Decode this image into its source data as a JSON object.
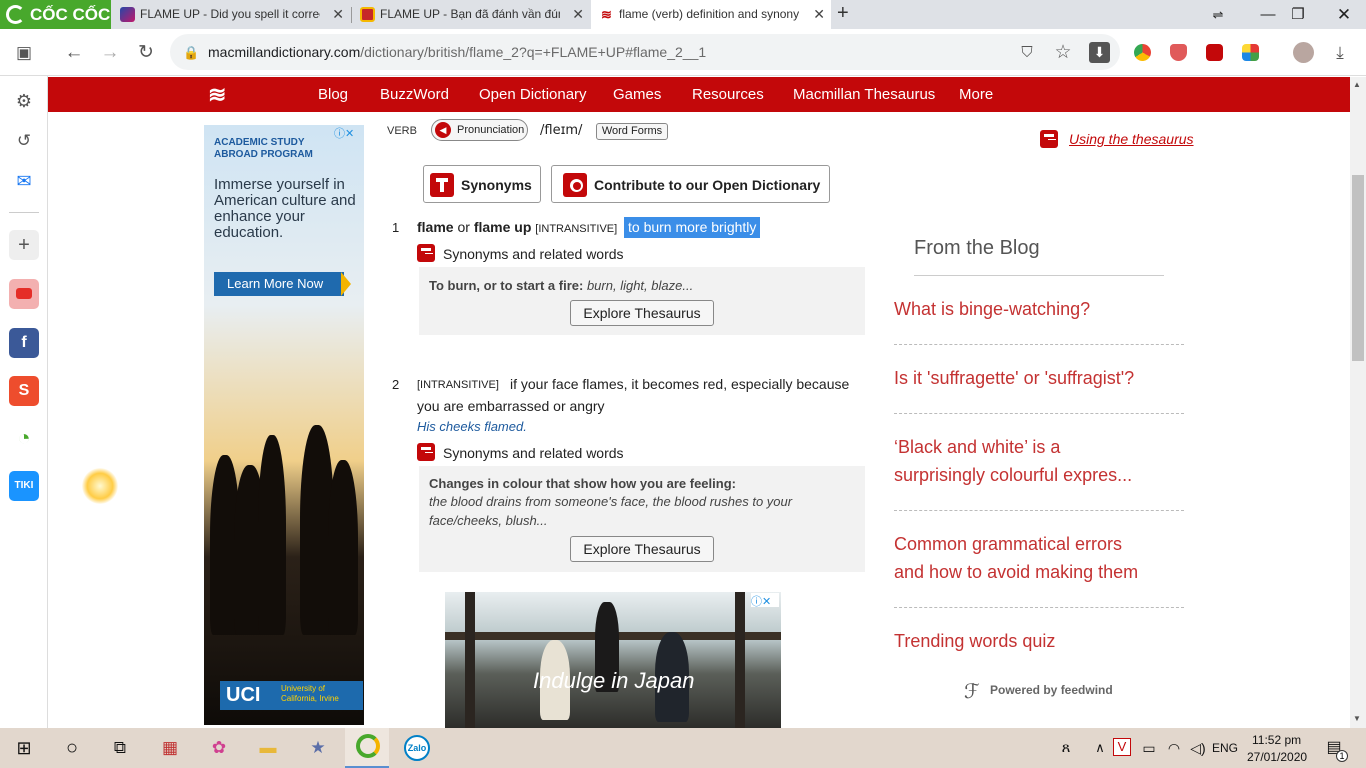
{
  "browser": {
    "brand": "CỐC CỐC",
    "tabs": [
      {
        "title": "FLAME UP - Did you spell it correctly",
        "active": false
      },
      {
        "title": "FLAME UP - Bạn đã đánh vần đúng",
        "active": false
      },
      {
        "title": "flame (verb) definition and synonyms",
        "active": true
      }
    ],
    "new_tab": "+",
    "url_host": "macmillandictionary.com",
    "url_path": "/dictionary/british/flame_2?q=+FLAME+UP#flame_2__1"
  },
  "site_nav": {
    "items": [
      "Blog",
      "BuzzWord",
      "Open Dictionary",
      "Games",
      "Resources",
      "Macmillan Thesaurus",
      "More"
    ]
  },
  "ad_left": {
    "kicker": "ACADEMIC STUDY ABROAD PROGRAM",
    "headline": "Immerse yourself in American culture and enhance your education.",
    "cta": "Learn More Now",
    "logo": "UCI",
    "logo_text": "University of California, Irvine"
  },
  "entry": {
    "pos": "VERB",
    "pronunciation_label": "Pronunciation",
    "ipa": "/fleɪm/",
    "word_forms": "Word Forms",
    "synonyms_btn": "Synonyms",
    "contribute_btn": "Contribute to our Open Dictionary",
    "thesaurus_link": "Using the thesaurus",
    "senses": [
      {
        "num": "1",
        "head1": "flame",
        "or": "or",
        "head2": "flame up",
        "label": "[INTRANSITIVE]",
        "definition": "to burn more brightly",
        "syn_label": "Synonyms and related words",
        "box_title": "To burn, or to start a fire:",
        "box_words": "burn, light, blaze...",
        "explore": "Explore Thesaurus"
      },
      {
        "num": "2",
        "label": "[INTRANSITIVE]",
        "definition_1": "if your face flames, it becomes red, especially because",
        "definition_2": "you are embarrassed or angry",
        "example": "His cheeks flamed.",
        "syn_label": "Synonyms and related words",
        "box_title": "Changes in colour that show how you are feeling:",
        "box_words_1": "the blood drains from someone's face, the blood rushes to your",
        "box_words_2": "face/cheeks, blush...",
        "explore": "Explore Thesaurus"
      }
    ]
  },
  "ad_bottom": {
    "caption": "Indulge in Japan"
  },
  "blog": {
    "heading": "From the Blog",
    "items": [
      [
        "What is binge-watching?"
      ],
      [
        "Is it 'suffragette' or 'suffragist'?"
      ],
      [
        "‘Black and white’ is a",
        "surprisingly colourful expres..."
      ],
      [
        "Common grammatical errors",
        "and how to avoid making them"
      ],
      [
        "Trending words quiz"
      ]
    ],
    "powered": "Powered by feedwind"
  },
  "taskbar": {
    "language": "ENG",
    "time": "11:52 pm",
    "date": "27/01/2020",
    "notification_count": "1",
    "app_zalo": "Zalo"
  },
  "colors": {
    "brand_red": "#c3080a",
    "blog_link": "#c43232",
    "highlight": "#3b8ee8",
    "coccoc_green": "#48a82c"
  }
}
